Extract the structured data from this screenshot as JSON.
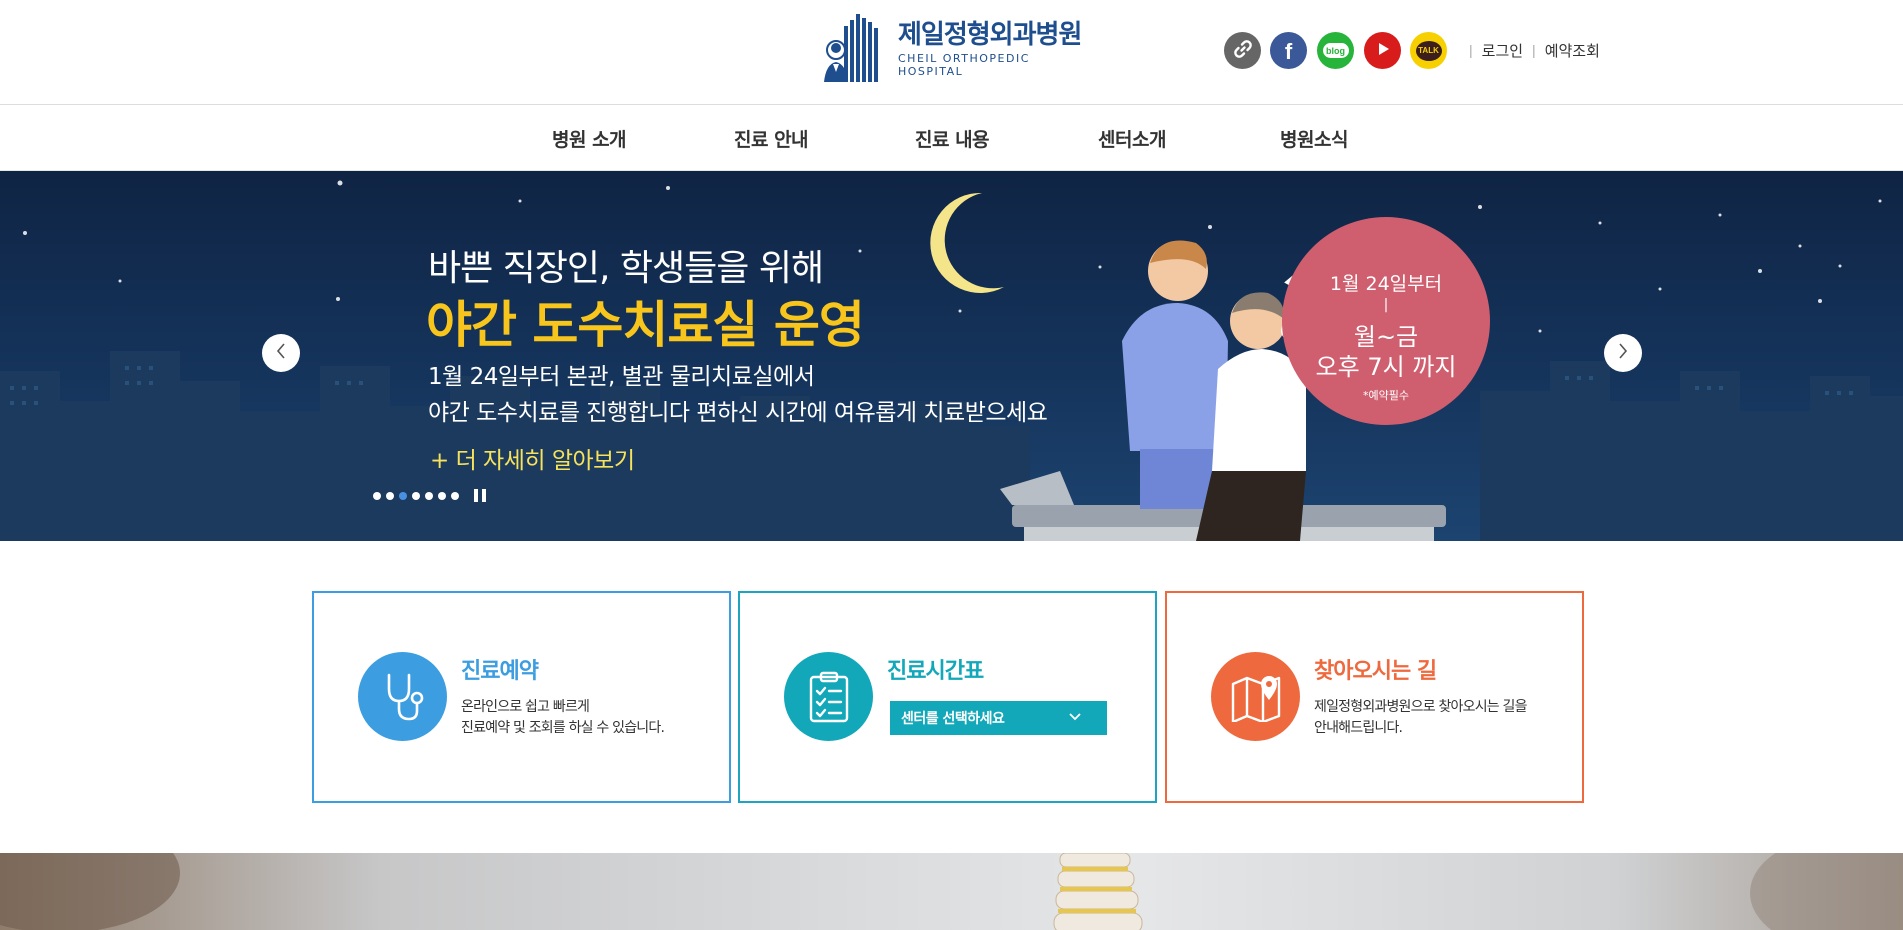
{
  "header": {
    "logo_kor": "제일정형외과병원",
    "logo_eng": "CHEIL ORTHOPEDIC HOSPITAL",
    "brand_color": "#1e4e8e",
    "social": [
      {
        "name": "link",
        "icon": "link-icon",
        "color": "#666666"
      },
      {
        "name": "facebook",
        "icon": "facebook-icon",
        "label": "f",
        "color": "#3b5998"
      },
      {
        "name": "blog",
        "icon": "blog-icon",
        "label": "blog",
        "color": "#27b43b"
      },
      {
        "name": "youtube",
        "icon": "youtube-icon",
        "color": "#d81b1b"
      },
      {
        "name": "kakaotalk",
        "icon": "kakaotalk-icon",
        "label": "TALK",
        "color": "#f6d000"
      }
    ],
    "util": {
      "login": "로그인",
      "reservation_check": "예약조회"
    }
  },
  "gnb": {
    "items": [
      "병원 소개",
      "진료 안내",
      "진료 내용",
      "센터소개",
      "병원소식"
    ]
  },
  "banner": {
    "line1": "바쁜 직장인, 학생들을 위해",
    "line2": "야간 도수치료실 운영",
    "line3": "1월 24일부터 본관, 별관 물리치료실에서",
    "line4": "야간 도수치료를 진행합니다 편하신 시간에 여유롭게 치료받으세요",
    "more": "+ 더 자세히 알아보기",
    "circle": {
      "line1": "1월 24일부터",
      "sep": "|",
      "line2": "월~금",
      "line3": "오후 7시 까지",
      "note": "*예약필수"
    },
    "slide_count": 7,
    "active_slide": 3,
    "accent_color": "#f8c51c",
    "circle_color": "#cf5e6f"
  },
  "quick": {
    "reserve": {
      "title": "진료예약",
      "desc1": "온라인으로 쉽고 빠르게",
      "desc2": "진료예약 및 조회를 하실 수 있습니다.",
      "icon": "stethoscope-icon",
      "color": "#3c9ee0"
    },
    "schedule": {
      "title": "진료시간표",
      "select_value": "센터를 선택하세요",
      "icon": "checklist-icon",
      "color": "#13a8b9"
    },
    "map": {
      "title": "찾아오시는 길",
      "desc1": "제일정형외과병원으로 찾아오시는 길을",
      "desc2": "안내해드립니다.",
      "icon": "map-pin-icon",
      "color": "#ee6a3e"
    }
  }
}
